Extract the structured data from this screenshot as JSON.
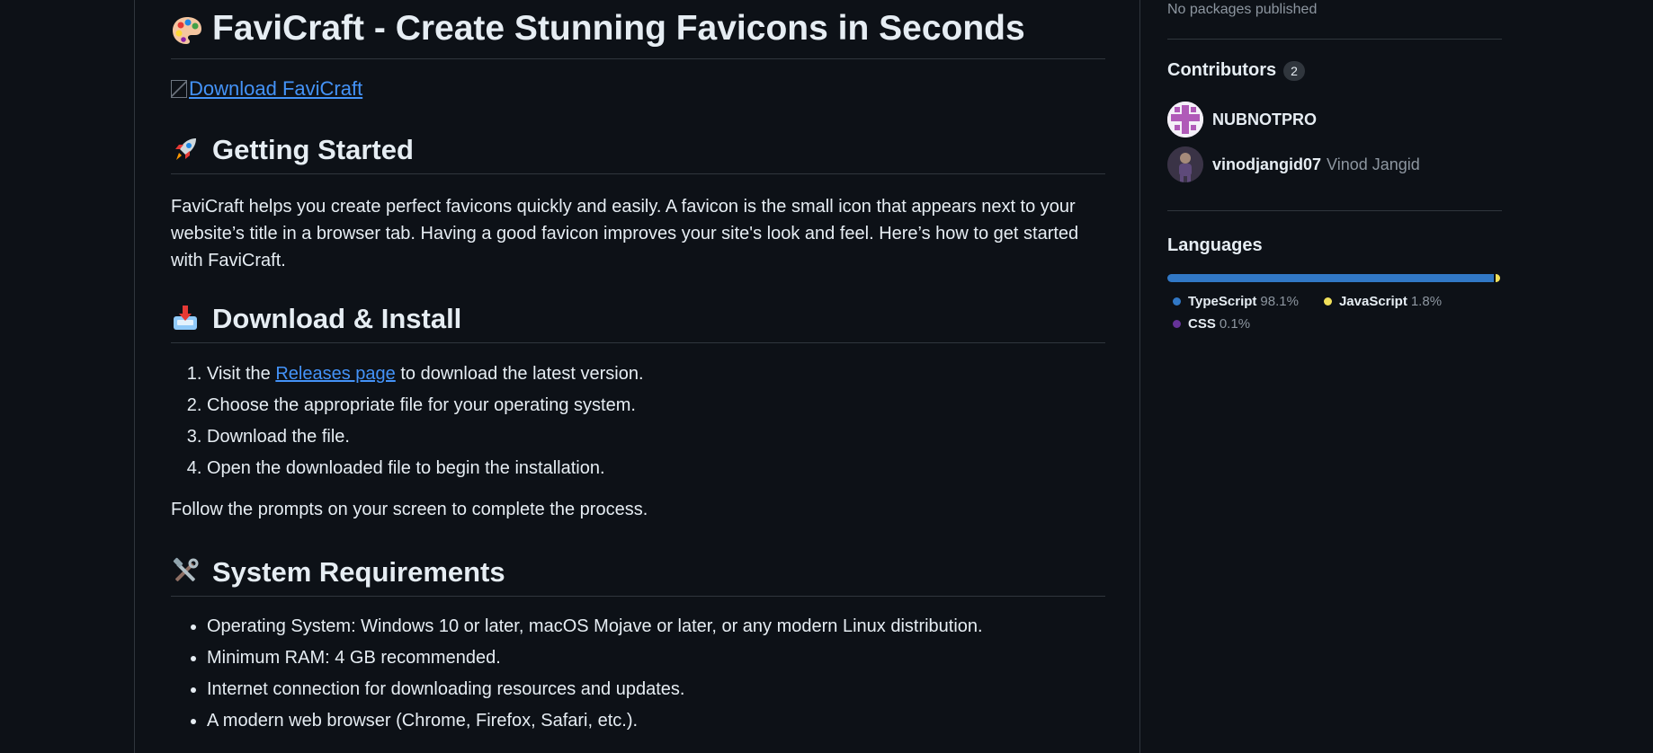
{
  "readme": {
    "title": "FaviCraft - Create Stunning Favicons in Seconds",
    "download_link": "Download FaviCraft",
    "getting_started": {
      "heading": "Getting Started",
      "body": "FaviCraft helps you create perfect favicons quickly and easily. A favicon is the small icon that appears next to your website’s title in a browser tab. Having a good favicon improves your site's look and feel. Here’s how to get started with FaviCraft."
    },
    "download_install": {
      "heading": "Download & Install",
      "step1_prefix": "Visit the ",
      "step1_link": "Releases page",
      "step1_suffix": " to download the latest version.",
      "step2": "Choose the appropriate file for your operating system.",
      "step3": "Download the file.",
      "step4": "Open the downloaded file to begin the installation.",
      "follow": "Follow the prompts on your screen to complete the process."
    },
    "system_requirements": {
      "heading": "System Requirements",
      "items": [
        "Operating System: Windows 10 or later, macOS Mojave or later, or any modern Linux distribution.",
        "Minimum RAM: 4 GB recommended.",
        "Internet connection for downloading resources and updates.",
        "A modern web browser (Chrome, Firefox, Safari, etc.)."
      ]
    }
  },
  "sidebar": {
    "packages_text": "No packages published",
    "contributors": {
      "heading": "Contributors",
      "count": "2",
      "list": [
        {
          "username": "NUBNOTPRO",
          "fullname": ""
        },
        {
          "username": "vinodjangid07",
          "fullname": "Vinod Jangid"
        }
      ]
    },
    "languages": {
      "heading": "Languages",
      "items": [
        {
          "name": "TypeScript",
          "percent": "98.1%",
          "value": 98.1,
          "color": "#3178c6"
        },
        {
          "name": "JavaScript",
          "percent": "1.8%",
          "value": 1.8,
          "color": "#f1e05a"
        },
        {
          "name": "CSS",
          "percent": "0.1%",
          "value": 0.1,
          "color": "#663399"
        }
      ]
    }
  }
}
